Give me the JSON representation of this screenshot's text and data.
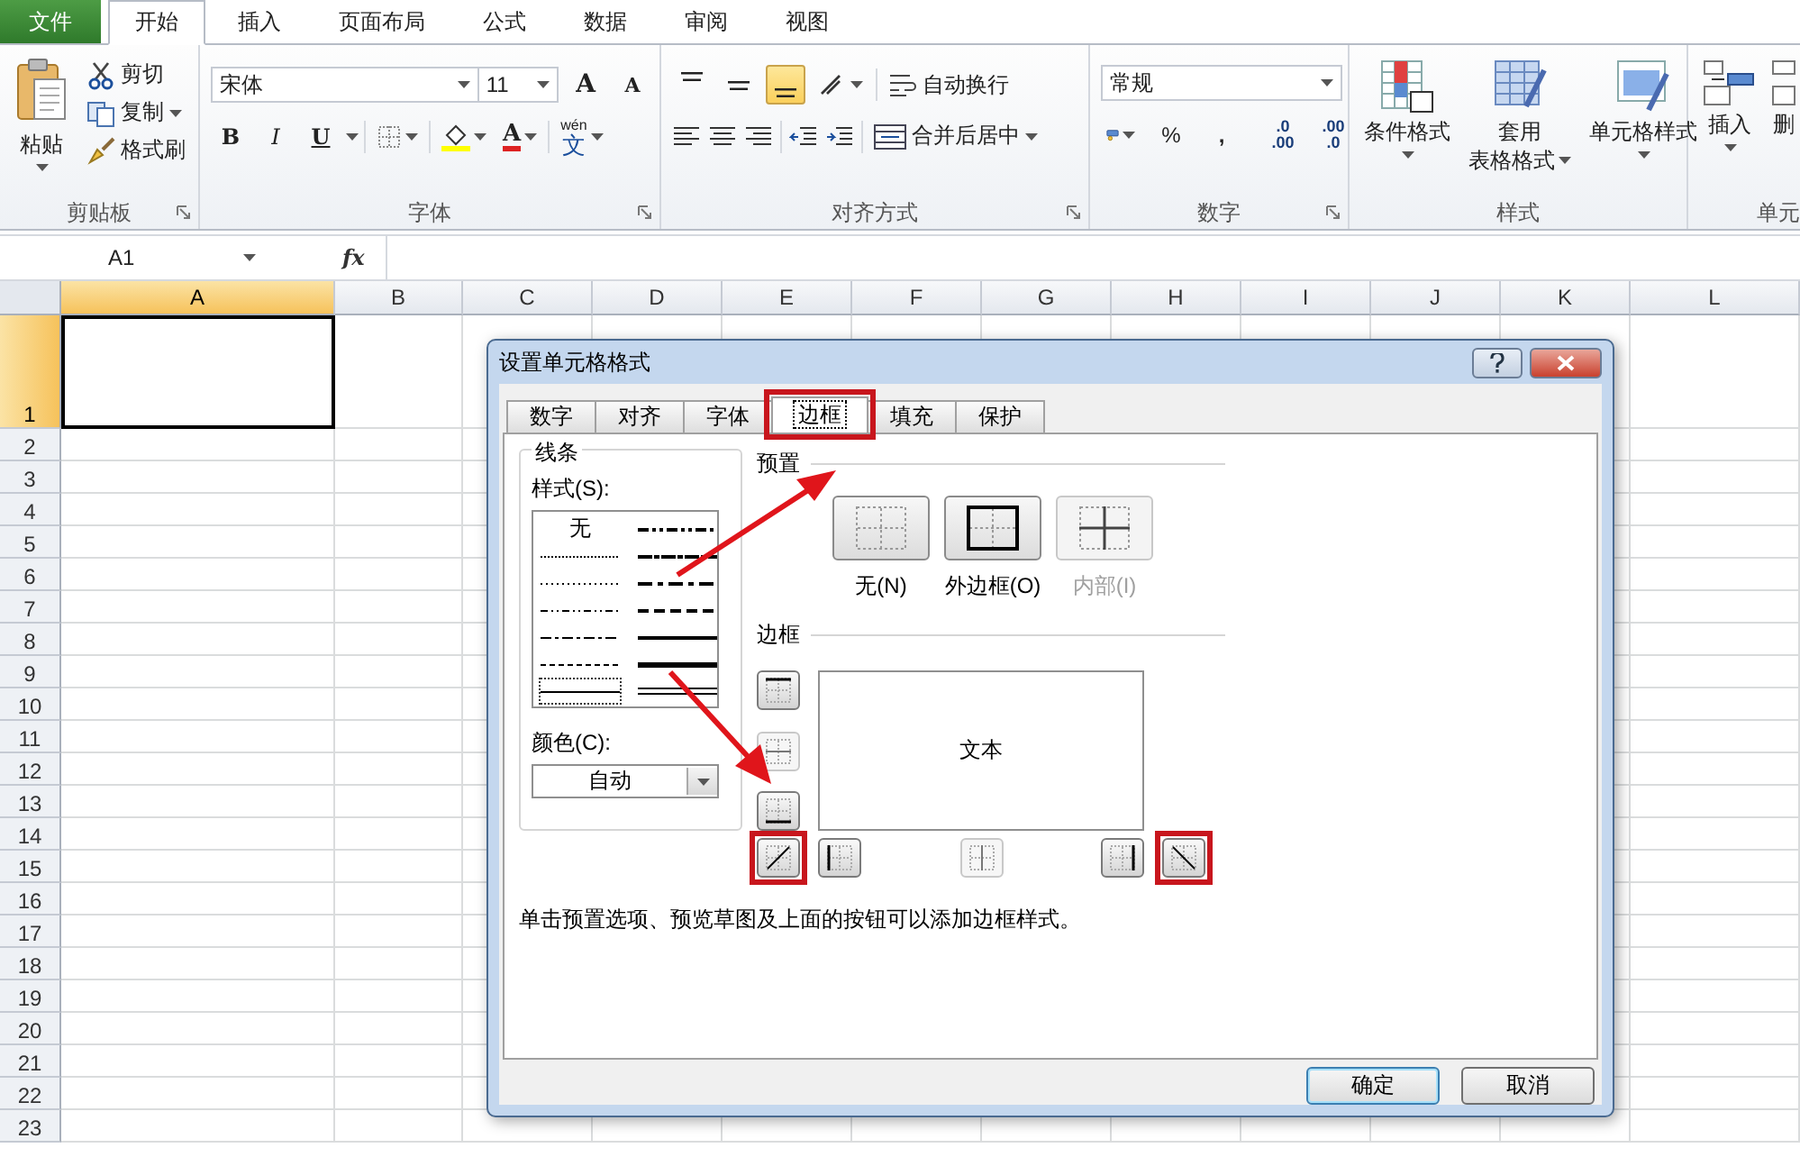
{
  "ribbon_tabs": [
    {
      "label": "文件",
      "kind": "file",
      "selected": false
    },
    {
      "label": "开始",
      "kind": "tab",
      "selected": true
    },
    {
      "label": "插入",
      "kind": "tab",
      "selected": false
    },
    {
      "label": "页面布局",
      "kind": "tab",
      "selected": false
    },
    {
      "label": "公式",
      "kind": "tab",
      "selected": false
    },
    {
      "label": "数据",
      "kind": "tab",
      "selected": false
    },
    {
      "label": "审阅",
      "kind": "tab",
      "selected": false
    },
    {
      "label": "视图",
      "kind": "tab",
      "selected": false
    }
  ],
  "clipboard": {
    "label": "剪贴板",
    "paste": "粘贴",
    "cut": "剪切",
    "copy": "复制",
    "format_painter": "格式刷"
  },
  "font": {
    "label": "字体",
    "font_name": "宋体",
    "font_size": "11",
    "grow": "A",
    "shrink": "A",
    "bold": "B",
    "italic": "I",
    "underline": "U",
    "font_color": "A",
    "phonetic_ruby": "wén",
    "phonetic_char": "文"
  },
  "alignment": {
    "label": "对齐方式",
    "vertical": [
      {
        "kind": "top",
        "selected": false
      },
      {
        "kind": "middle",
        "selected": false
      },
      {
        "kind": "bottom",
        "selected": true
      }
    ],
    "wrap_text": "自动换行",
    "merge_center": "合并后居中"
  },
  "number": {
    "label": "数字",
    "format": "常规",
    "percent": "%",
    "comma": ",",
    "increase_decimal": [
      ".0",
      ".00"
    ],
    "decrease_decimal": [
      ".00",
      ".0"
    ]
  },
  "styles": {
    "label": "样式",
    "conditional": "条件格式",
    "format_table": [
      "套用",
      "表格格式"
    ],
    "cell_styles": "单元格样式"
  },
  "cells": {
    "label": "单元",
    "insert": "插入",
    "delete": "删"
  },
  "formula_bar": {
    "name_box": "A1",
    "fx": "fx"
  },
  "sheet": {
    "columns": [
      {
        "label": "A",
        "selected": true
      },
      {
        "label": "B",
        "selected": false
      },
      {
        "label": "C",
        "selected": false
      },
      {
        "label": "D",
        "selected": false
      },
      {
        "label": "E",
        "selected": false
      },
      {
        "label": "F",
        "selected": false
      },
      {
        "label": "G",
        "selected": false
      },
      {
        "label": "H",
        "selected": false
      },
      {
        "label": "I",
        "selected": false
      },
      {
        "label": "J",
        "selected": false
      },
      {
        "label": "K",
        "selected": false
      },
      {
        "label": "L",
        "selected": false
      }
    ],
    "rows": [
      {
        "label": "1",
        "selected": true
      },
      {
        "label": "2",
        "selected": false
      },
      {
        "label": "3",
        "selected": false
      },
      {
        "label": "4",
        "selected": false
      },
      {
        "label": "5",
        "selected": false
      },
      {
        "label": "6",
        "selected": false
      },
      {
        "label": "7",
        "selected": false
      },
      {
        "label": "8",
        "selected": false
      },
      {
        "label": "9",
        "selected": false
      },
      {
        "label": "10",
        "selected": false
      },
      {
        "label": "11",
        "selected": false
      },
      {
        "label": "12",
        "selected": false
      },
      {
        "label": "13",
        "selected": false
      },
      {
        "label": "14",
        "selected": false
      },
      {
        "label": "15",
        "selected": false
      },
      {
        "label": "16",
        "selected": false
      },
      {
        "label": "17",
        "selected": false
      },
      {
        "label": "18",
        "selected": false
      },
      {
        "label": "19",
        "selected": false
      },
      {
        "label": "20",
        "selected": false
      },
      {
        "label": "21",
        "selected": false
      },
      {
        "label": "22",
        "selected": false
      },
      {
        "label": "23",
        "selected": false
      }
    ]
  },
  "dialog": {
    "title": "设置单元格格式",
    "tabs": [
      {
        "label": "数字",
        "selected": false,
        "highlighted": false
      },
      {
        "label": "对齐",
        "selected": false,
        "highlighted": false
      },
      {
        "label": "字体",
        "selected": false,
        "highlighted": false
      },
      {
        "label": "边框",
        "selected": true,
        "highlighted": true
      },
      {
        "label": "填充",
        "selected": false,
        "highlighted": false
      },
      {
        "label": "保护",
        "selected": false,
        "highlighted": false
      }
    ],
    "line": {
      "title": "线条",
      "style_label": "样式(S):",
      "styles": [
        {
          "kind": "none",
          "label": "无",
          "selected": false
        },
        {
          "kind": "hair",
          "selected": false
        },
        {
          "kind": "dotted",
          "selected": false
        },
        {
          "kind": "dash-dot-dot",
          "selected": false
        },
        {
          "kind": "dash-dot",
          "selected": false
        },
        {
          "kind": "dashed",
          "selected": false
        },
        {
          "kind": "thin",
          "selected": true
        },
        {
          "kind": "medium-dash-dot-dot",
          "selected": false
        },
        {
          "kind": "slant-dash-dot",
          "selected": false
        },
        {
          "kind": "medium-dash-dot",
          "selected": false
        },
        {
          "kind": "medium-dashed",
          "selected": false
        },
        {
          "kind": "medium",
          "selected": false
        },
        {
          "kind": "thick",
          "selected": false
        },
        {
          "kind": "double",
          "selected": false
        }
      ],
      "color_label": "颜色(C):",
      "color_value": "自动"
    },
    "presets": {
      "title": "预置",
      "items": [
        {
          "kind": "none",
          "label": "无(N)",
          "disabled": false
        },
        {
          "kind": "outline",
          "label": "外边框(O)",
          "disabled": false
        },
        {
          "kind": "inside",
          "label": "内部(I)",
          "disabled": true
        }
      ]
    },
    "border": {
      "title": "边框",
      "preview_text": "文本",
      "side_buttons": [
        {
          "kind": "top",
          "disabled": false,
          "highlighted": false
        },
        {
          "kind": "inside-horizontal",
          "disabled": true,
          "highlighted": false
        },
        {
          "kind": "bottom",
          "disabled": false,
          "highlighted": false
        }
      ],
      "bottom_buttons": [
        {
          "kind": "diagonal-up",
          "disabled": false,
          "highlighted": true
        },
        {
          "kind": "left",
          "disabled": false,
          "highlighted": false
        },
        {
          "kind": "inside-vertical",
          "disabled": true,
          "highlighted": false
        },
        {
          "kind": "right",
          "disabled": false,
          "highlighted": false
        },
        {
          "kind": "diagonal-down",
          "disabled": false,
          "highlighted": true
        }
      ]
    },
    "hint": "单击预置选项、预览草图及上面的按钮可以添加边框样式。",
    "buttons": [
      {
        "label": "确定",
        "kind": "default"
      },
      {
        "label": "取消",
        "kind": "normal"
      }
    ]
  }
}
